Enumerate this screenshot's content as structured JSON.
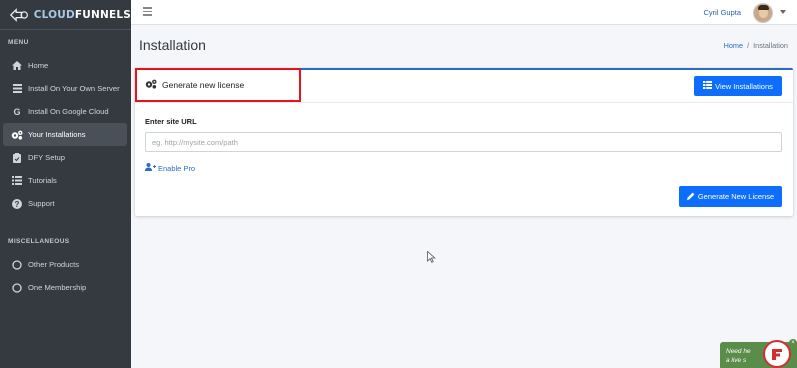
{
  "brand": {
    "prefix": "CLOUD",
    "suffix": "FUNNELS"
  },
  "sidebar": {
    "menu_header": "MENU",
    "items": [
      {
        "label": "Home",
        "icon": "home-icon"
      },
      {
        "label": "Install On Your Own Server",
        "icon": "server-icon"
      },
      {
        "label": "Install On Google Cloud",
        "icon": "google-icon"
      },
      {
        "label": "Your Installations",
        "icon": "cogs-icon",
        "active": true
      },
      {
        "label": "DFY Setup",
        "icon": "clipboard-icon"
      },
      {
        "label": "Tutorials",
        "icon": "list-icon"
      },
      {
        "label": "Support",
        "icon": "question-icon"
      }
    ],
    "misc_header": "MISCELLANEOUS",
    "misc_items": [
      {
        "label": "Other Products",
        "icon": "circle-icon"
      },
      {
        "label": "One Membership",
        "icon": "circle-icon"
      }
    ]
  },
  "topbar": {
    "user_name": "Cyril Gupta"
  },
  "page": {
    "title": "Installation",
    "breadcrumb": {
      "home": "Home",
      "separator": "/",
      "current": "Installation"
    }
  },
  "card": {
    "title": "Generate new license",
    "view_button": "View Installations",
    "field_label": "Enter site URL",
    "url_placeholder": "eg. http://mysite.com/path",
    "url_value": "",
    "enable_pro": "Enable Pro",
    "generate_button": "Generate New License"
  },
  "chat": {
    "text_line1": "Need he",
    "text_line2": "a live s"
  },
  "colors": {
    "accent": "#0d6efd",
    "sidebar": "#343a40",
    "highlight": "#e8121c"
  }
}
